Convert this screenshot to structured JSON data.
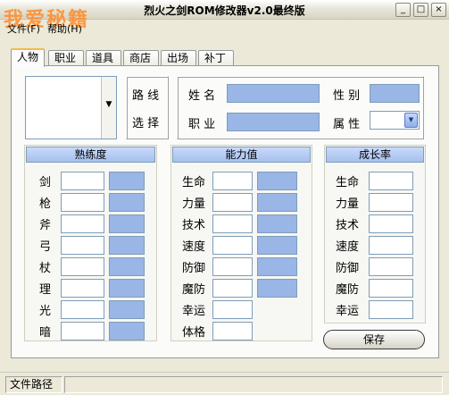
{
  "window": {
    "title": "烈火之剑ROM修改器v2.0最终版",
    "watermark": "我爱秘籍",
    "controls": [
      "_",
      "□",
      "×"
    ]
  },
  "menu": {
    "file": "文件(F)",
    "help": "帮助(H)"
  },
  "tabs": [
    "人物",
    "职业",
    "道具",
    "商店",
    "出场",
    "补丁"
  ],
  "character": {
    "route_label_1": "路 线",
    "route_label_2": "选 择",
    "name_label": "姓 名",
    "gender_label": "性 别",
    "class_label": "职 业",
    "attribute_label": "属 性",
    "name_value": "",
    "gender_value": "",
    "class_value": "",
    "attribute_value": ""
  },
  "proficiency": {
    "title": "熟练度",
    "rows": [
      "剑",
      "枪",
      "斧",
      "弓",
      "杖",
      "理",
      "光",
      "暗"
    ]
  },
  "ability": {
    "title": "能力值",
    "rows_with_extra": [
      "生命",
      "力量",
      "技术",
      "速度",
      "防御",
      "魔防"
    ],
    "rows_single": [
      "幸运",
      "体格"
    ]
  },
  "growth": {
    "title": "成长率",
    "rows": [
      "生命",
      "力量",
      "技术",
      "速度",
      "防御",
      "魔防",
      "幸运"
    ]
  },
  "buttons": {
    "save": "保存"
  },
  "status": {
    "file_path_label": "文件路径",
    "file_path_value": ""
  },
  "colors": {
    "field_blue": "#99b6e6",
    "header_blue": "#b5cbf3",
    "watermark": "#ff8a2a"
  }
}
